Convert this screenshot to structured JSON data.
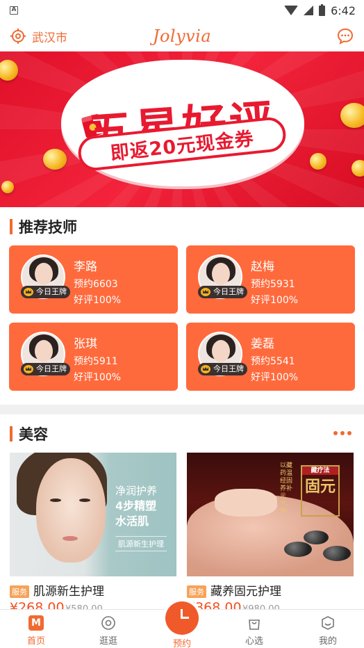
{
  "status_bar": {
    "time": "6:42",
    "notification_icon": "A"
  },
  "header": {
    "city": "武汉市",
    "brand": "Jolyvia"
  },
  "banner": {
    "title": "五星好评",
    "subtitle": "即返20元现金券",
    "red_packet_mark": "¥"
  },
  "technicians": {
    "title": "推荐技师",
    "items": [
      {
        "name": "李路",
        "bookings": "预约6603",
        "rating": "好评100%",
        "badge": "今日王牌"
      },
      {
        "name": "赵梅",
        "bookings": "预约5931",
        "rating": "好评100%",
        "badge": "今日王牌"
      },
      {
        "name": "张琪",
        "bookings": "预约5911",
        "rating": "好评100%",
        "badge": "今日王牌"
      },
      {
        "name": "姜磊",
        "bookings": "预约5541",
        "rating": "好评100%",
        "badge": "今日王牌"
      }
    ]
  },
  "beauty": {
    "title": "美容",
    "products": [
      {
        "tag": "服务",
        "name": "肌源新生护理",
        "price": "¥268.00",
        "original_price": "¥580.00",
        "image_lines": [
          "净润护养",
          "4步精塑",
          "水活肌"
        ],
        "image_sub": "肌源新生护理"
      },
      {
        "tag": "服务",
        "name": "藏养固元护理",
        "price": "¥368.00",
        "original_price": "¥980.00",
        "image_title": "固元",
        "image_tag": "藏疗法",
        "image_vtext": "以藏药温经固养补元气，神"
      }
    ]
  },
  "tabbar": {
    "tabs": [
      {
        "label": "首页",
        "icon": "home-icon",
        "active": true
      },
      {
        "label": "逛逛",
        "icon": "explore-icon",
        "active": false
      },
      {
        "label": "预约",
        "icon": "clock-icon",
        "active": false
      },
      {
        "label": "心选",
        "icon": "bag-icon",
        "active": false
      },
      {
        "label": "我的",
        "icon": "profile-icon",
        "active": false
      }
    ]
  },
  "colors": {
    "accent": "#f06a32",
    "card": "#ff6a3c",
    "banner_red": "#e81a30",
    "price": "#f05020"
  }
}
